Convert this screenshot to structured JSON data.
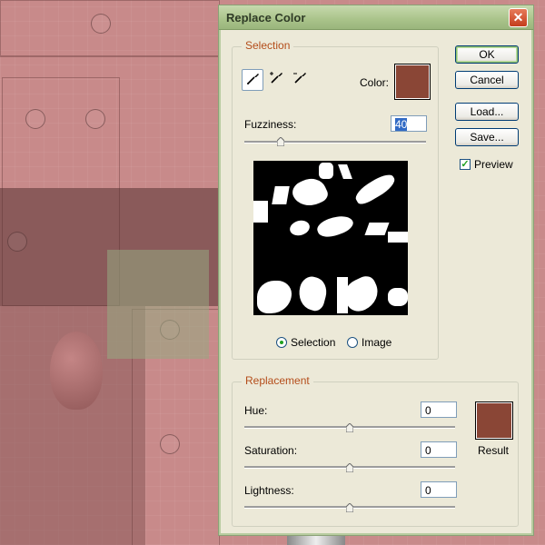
{
  "dialog": {
    "title": "Replace Color",
    "close_label": "✕"
  },
  "buttons": {
    "ok": "OK",
    "cancel": "Cancel",
    "load": "Load...",
    "save": "Save..."
  },
  "preview_option": {
    "label": "Preview",
    "checked": true
  },
  "selection": {
    "group_label": "Selection",
    "color_label": "Color:",
    "color": "#8a4636",
    "fuzziness_label": "Fuzziness:",
    "fuzziness_value": "40",
    "fuzziness_fraction": 0.2,
    "view_modes": [
      "Selection",
      "Image"
    ],
    "selected_view": "Selection",
    "tools": [
      "eyedropper-icon",
      "eyedropper-plus-icon",
      "eyedropper-minus-icon"
    ]
  },
  "replacement": {
    "group_label": "Replacement",
    "hue_label": "Hue:",
    "hue_value": "0",
    "hue_fraction": 0.5,
    "saturation_label": "Saturation:",
    "saturation_value": "0",
    "saturation_fraction": 0.5,
    "lightness_label": "Lightness:",
    "lightness_value": "0",
    "lightness_fraction": 0.5,
    "result_label": "Result",
    "result_color": "#8a4636"
  }
}
